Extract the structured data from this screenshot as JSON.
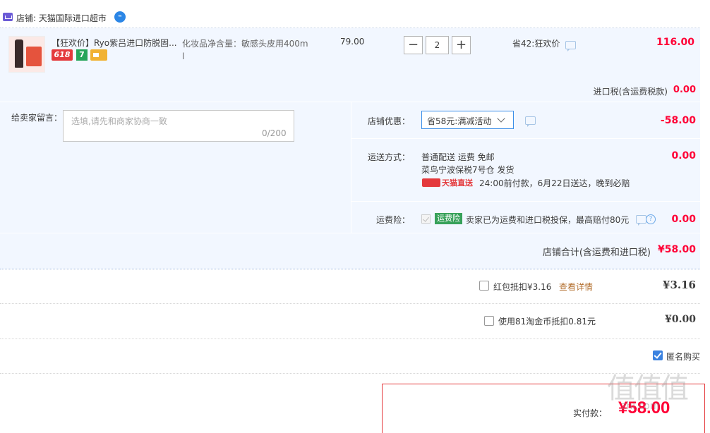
{
  "store": {
    "label": "店铺: 天猫国际进口超市",
    "wang_glyph": "ꟹ"
  },
  "item": {
    "title": "【狂欢价】Ryo紫吕进口防脱固...",
    "tags": {
      "tag618": "618",
      "tag7": "7"
    },
    "sku_line1": "化妆品净含量：敏感头皮用400m",
    "sku_line2": "l",
    "price": "79.00",
    "quantity": "2",
    "minus": "−",
    "plus": "+",
    "save": "省42:狂欢价",
    "total": "116.00"
  },
  "import_tax": {
    "label": "进口税(含运费税款)",
    "value": "0.00"
  },
  "message": {
    "label": "给卖家留言：",
    "placeholder": "选填,请先和商家协商一致",
    "count": "0/200"
  },
  "promo": {
    "label": "店铺优惠：",
    "selected": "省58元:满减活动",
    "value": "-58.00"
  },
  "shipping": {
    "label": "运送方式：",
    "line1": "普通配送 运费 免邮",
    "line2": "菜鸟宁波保税7号仓   发货",
    "badge": "天猫直送",
    "line3": "24:00前付款，6月22日送达，晚到必赔",
    "value": "0.00"
  },
  "insurance": {
    "label": "运费险：",
    "badge": "运费险",
    "text": "卖家已为运费和进口税投保，最高赔付80元",
    "help": "?",
    "value": "0.00"
  },
  "store_total": {
    "label": "店铺合计(含运费和进口税)",
    "value": "¥58.00"
  },
  "red_packet": {
    "label": "红包抵扣¥3.16",
    "link": "查看详情",
    "value": "¥3.16"
  },
  "coins": {
    "label": "使用81淘金币抵扣0.81元",
    "value": "¥0.00"
  },
  "anonymous": {
    "label": "匿名购买"
  },
  "payment": {
    "label": "实付款：",
    "value": "¥58.00"
  },
  "watermark": {
    "glyphs": "值值值",
    "url": "zhi.com"
  }
}
